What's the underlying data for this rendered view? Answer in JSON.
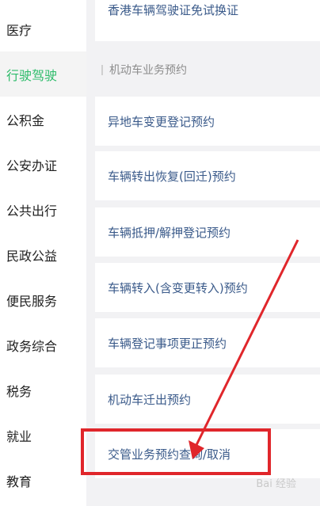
{
  "sidebar": {
    "items": [
      {
        "label": "医疗"
      },
      {
        "label": "行驶驾驶"
      },
      {
        "label": "公积金"
      },
      {
        "label": "公安办证"
      },
      {
        "label": "公共出行"
      },
      {
        "label": "民政公益"
      },
      {
        "label": "便民服务"
      },
      {
        "label": "政务综合"
      },
      {
        "label": "税务"
      },
      {
        "label": "就业"
      },
      {
        "label": "教育"
      }
    ],
    "active_index": 1
  },
  "content": {
    "top_item": "香港车辆驾驶证免试换证",
    "section_title": "机动车业务预约",
    "items": [
      {
        "label": "异地车变更登记预约"
      },
      {
        "label": "车辆转出恢复(回迁)预约"
      },
      {
        "label": "车辆抵押/解押登记预约"
      },
      {
        "label": "车辆转入(含变更转入)预约"
      },
      {
        "label": "车辆登记事项更正预约"
      },
      {
        "label": "机动车迁出预约"
      },
      {
        "label": "交管业务预约查询/取消"
      }
    ]
  },
  "watermark": "Bai 经验",
  "colors": {
    "active": "#2dbb6a",
    "link": "#3a5a8a",
    "annotation": "#e0262b"
  }
}
